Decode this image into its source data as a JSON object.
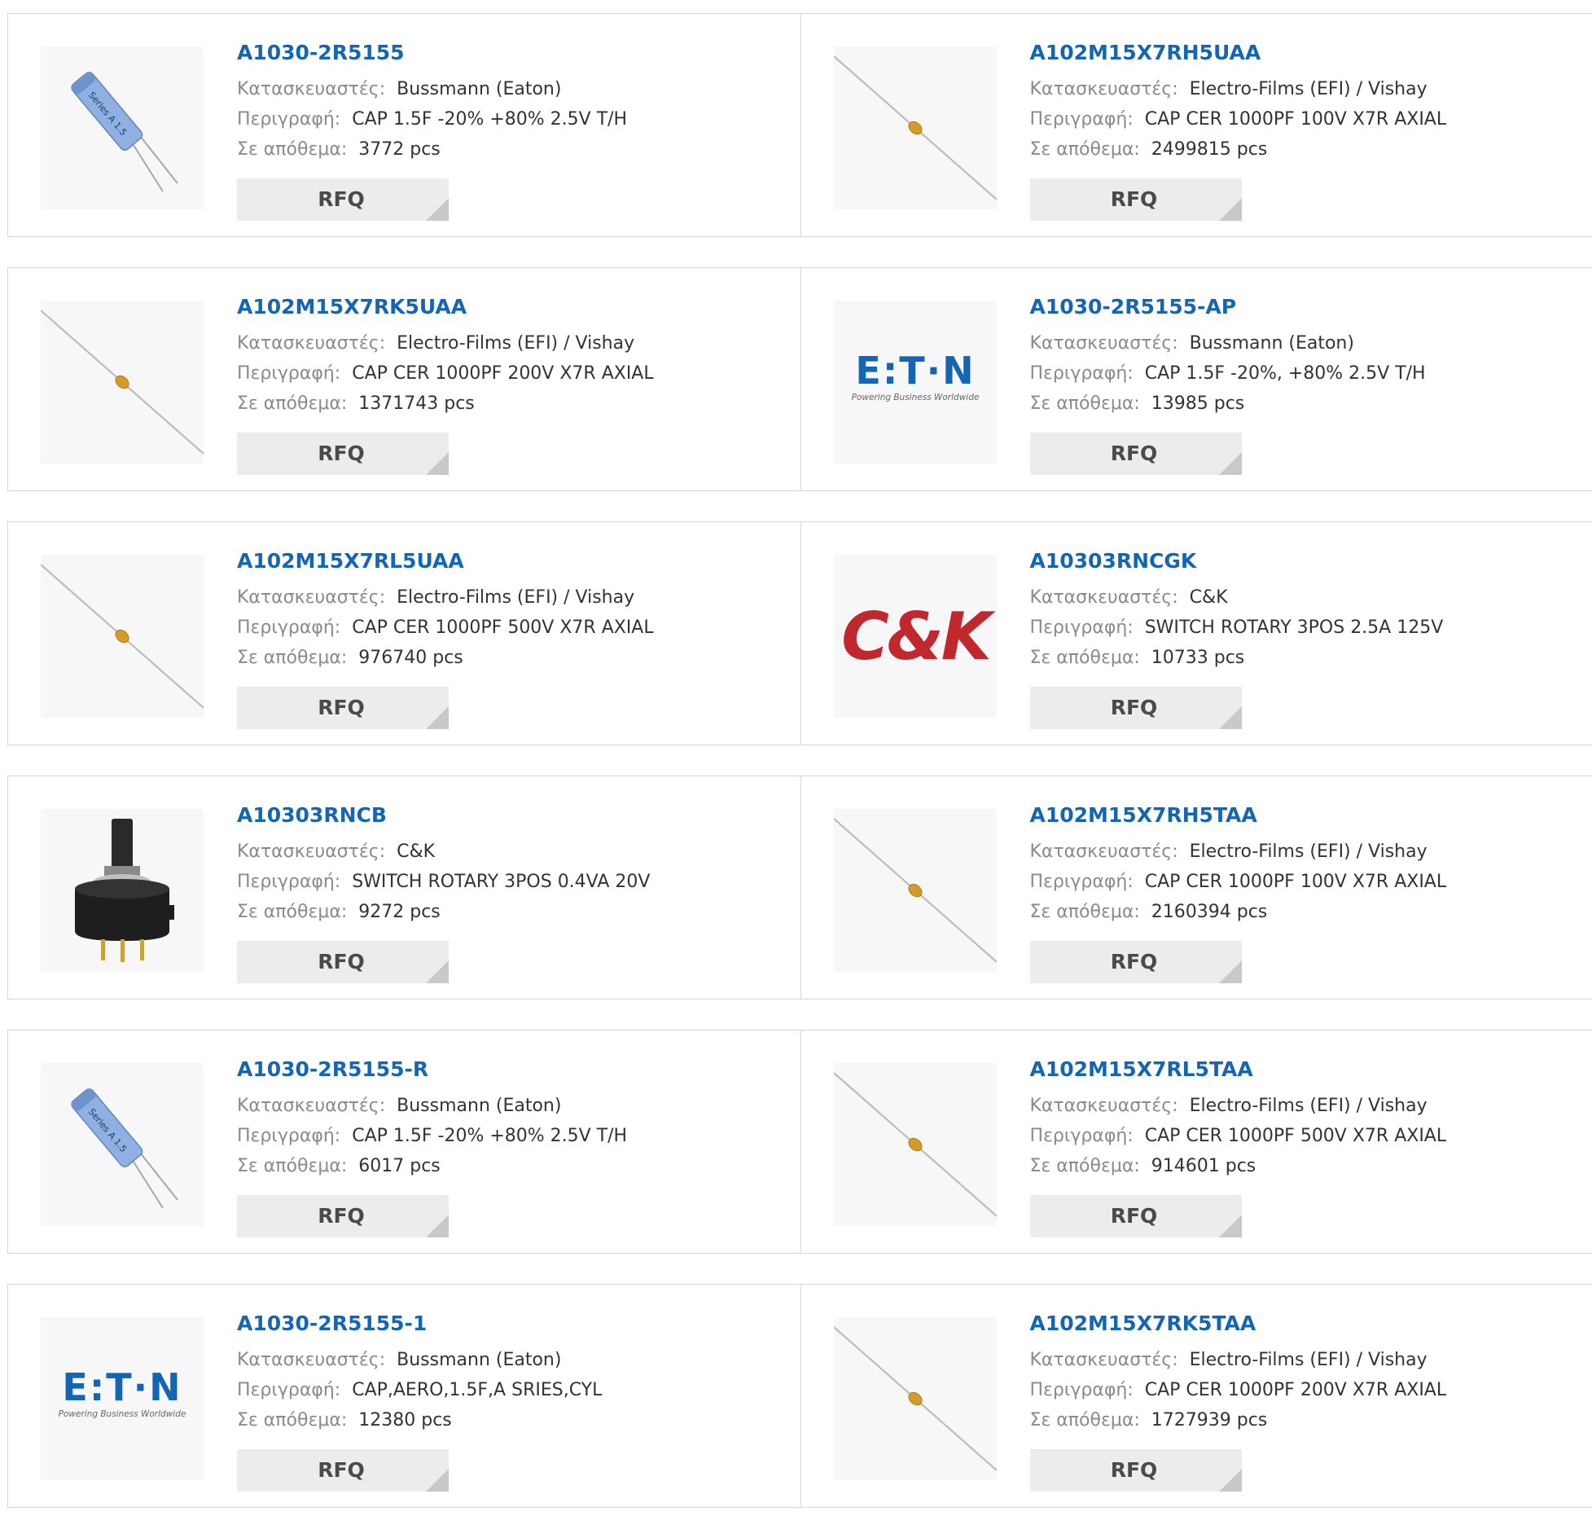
{
  "labels": {
    "manufacturer": "Κατασκευαστές:",
    "description": "Περιγραφή:",
    "stock": "Σε απόθεμα:",
    "rfq": "RFQ"
  },
  "colors": {
    "part_link": "#1565b5",
    "label": "#8a8a8a",
    "rfq_bg": "#ececec",
    "border": "#d6d6d6"
  },
  "rows": [
    [
      {
        "part": "A1030-2R5155",
        "manufacturer": "Bussmann (Eaton)",
        "description": "CAP 1.5F -20% +80% 2.5V T/H",
        "stock": "3772 pcs",
        "image": "supercap-icon"
      },
      {
        "part": "A102M15X7RH5UAA",
        "manufacturer": "Electro-Films (EFI) / Vishay",
        "description": "CAP CER 1000PF 100V X7R AXIAL",
        "stock": "2499815 pcs",
        "image": "axial-capacitor-icon"
      }
    ],
    [
      {
        "part": "A102M15X7RK5UAA",
        "manufacturer": "Electro-Films (EFI) / Vishay",
        "description": "CAP CER 1000PF 200V X7R AXIAL",
        "stock": "1371743 pcs",
        "image": "axial-capacitor-icon"
      },
      {
        "part": "A1030-2R5155-AP",
        "manufacturer": "Bussmann (Eaton)",
        "description": "CAP 1.5F -20%, +80% 2.5V T/H",
        "stock": "13985 pcs",
        "image": "eaton-logo"
      }
    ],
    [
      {
        "part": "A102M15X7RL5UAA",
        "manufacturer": "Electro-Films (EFI) / Vishay",
        "description": "CAP CER 1000PF 500V X7R AXIAL",
        "stock": "976740 pcs",
        "image": "axial-capacitor-icon"
      },
      {
        "part": "A10303RNCGK",
        "manufacturer": "C&K",
        "description": "SWITCH ROTARY 3POS 2.5A 125V",
        "stock": "10733 pcs",
        "image": "ck-logo"
      }
    ],
    [
      {
        "part": "A10303RNCB",
        "manufacturer": "C&K",
        "description": "SWITCH ROTARY 3POS 0.4VA 20V",
        "stock": "9272 pcs",
        "image": "rotary-switch-icon"
      },
      {
        "part": "A102M15X7RH5TAA",
        "manufacturer": "Electro-Films (EFI) / Vishay",
        "description": "CAP CER 1000PF 100V X7R AXIAL",
        "stock": "2160394 pcs",
        "image": "axial-capacitor-icon"
      }
    ],
    [
      {
        "part": "A1030-2R5155-R",
        "manufacturer": "Bussmann (Eaton)",
        "description": "CAP 1.5F -20% +80% 2.5V T/H",
        "stock": "6017 pcs",
        "image": "supercap-icon"
      },
      {
        "part": "A102M15X7RL5TAA",
        "manufacturer": "Electro-Films (EFI) / Vishay",
        "description": "CAP CER 1000PF 500V X7R AXIAL",
        "stock": "914601 pcs",
        "image": "axial-capacitor-icon"
      }
    ],
    [
      {
        "part": "A1030-2R5155-1",
        "manufacturer": "Bussmann (Eaton)",
        "description": "CAP,AERO,1.5F,A SRIES,CYL",
        "stock": "12380 pcs",
        "image": "eaton-logo"
      },
      {
        "part": "A102M15X7RK5TAA",
        "manufacturer": "Electro-Films (EFI) / Vishay",
        "description": "CAP CER 1000PF 200V X7R AXIAL",
        "stock": "1727939 pcs",
        "image": "axial-capacitor-icon"
      }
    ]
  ],
  "logos": {
    "eaton_text": "E:T·N",
    "eaton_tagline": "Powering Business Worldwide",
    "ck_text": "C&K"
  }
}
